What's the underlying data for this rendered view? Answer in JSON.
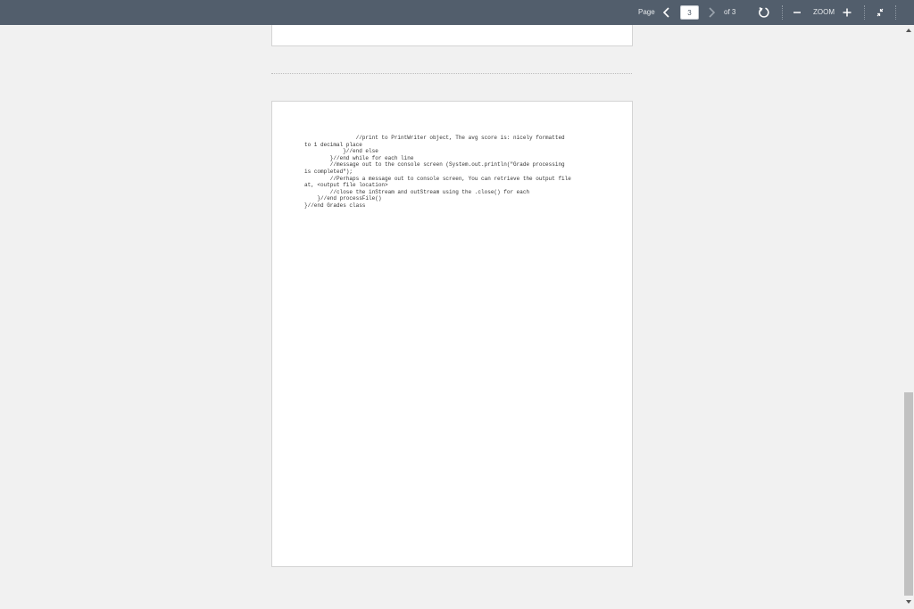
{
  "toolbar": {
    "page_label": "Page",
    "current_page": "3",
    "of_label": "of 3",
    "zoom_label": "ZOOM",
    "icons": {
      "prev": "chevron-left-icon",
      "next": "chevron-right-icon",
      "rotate": "rotate-icon",
      "zoom_out": "minus-icon",
      "zoom_in": "plus-icon",
      "collapse": "collapse-icon"
    }
  },
  "document": {
    "code_lines": [
      "                //print to PrintWriter object, The avg score is: nicely formatted",
      "to 1 decimal place",
      "            }//end else",
      "        }//end while for each line",
      "        //message out to the console screen (System.out.println(\"Grade processing",
      "is completed\");",
      "        //Perhaps a message out to console screen, You can retrieve the output file",
      "at, <output file location>",
      "        //close the inStream and outStream using the .close() for each",
      "    }//end processFile()",
      "}//end Grades class"
    ]
  },
  "colors": {
    "toolbar_bg": "#525e6c",
    "viewer_bg": "#f1f1f1",
    "page_bg": "#ffffff"
  }
}
